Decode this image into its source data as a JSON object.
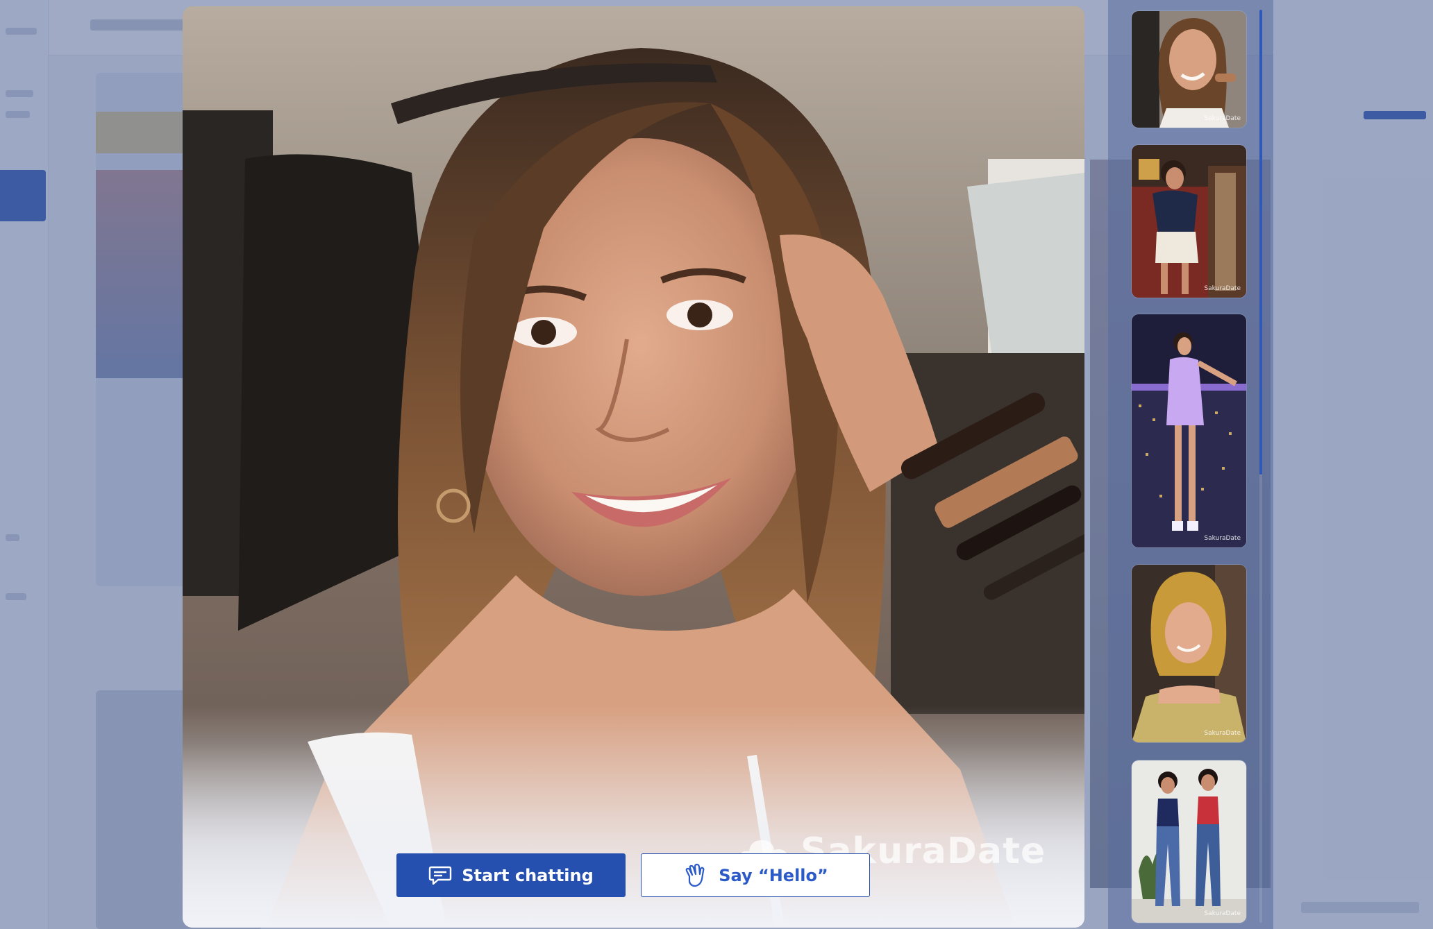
{
  "viewer": {
    "watermark_text": "SakuraDate",
    "actions": {
      "start_chatting_label": "Start chatting",
      "say_hello_label": "Say “Hello”"
    }
  },
  "thumbnails": {
    "items": [
      {
        "watermark": "SakuraDate",
        "selected": true
      },
      {
        "watermark": "SakuraDate",
        "selected": false
      },
      {
        "watermark": "SakuraDate",
        "selected": false
      },
      {
        "watermark": "SakuraDate",
        "selected": false
      },
      {
        "watermark": "SakuraDate",
        "selected": false
      }
    ]
  },
  "icons": {
    "chat": "chat-bubble-icon",
    "hello": "waving-hand-icon",
    "logo": "cloud-logo-icon"
  },
  "colors": {
    "primary": "#2550b0",
    "primary_text": "#2c5bc8",
    "overlay": "#4c6091"
  }
}
